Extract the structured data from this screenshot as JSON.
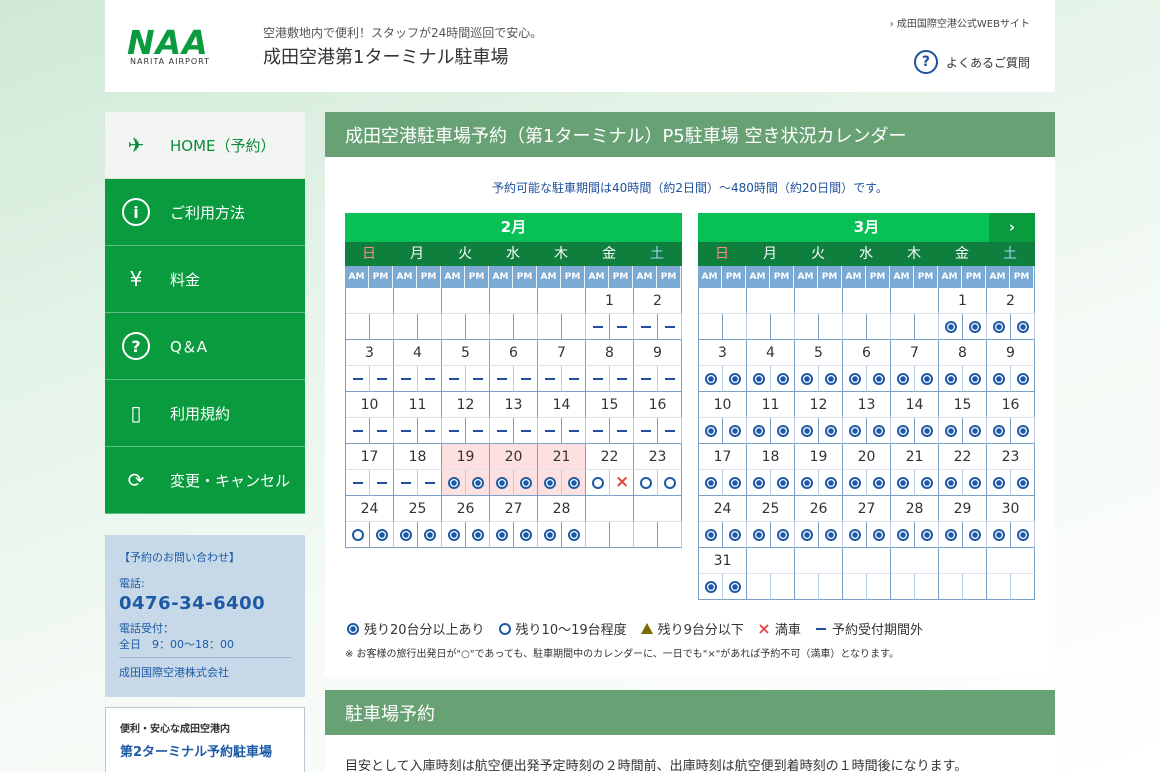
{
  "header": {
    "logo_text": "NAA",
    "logo_sub": "NARITA AIRPORT",
    "tagline": "空港敷地内で便利！スタッフが24時間巡回で安心。",
    "site_title": "成田空港第1ターミナル駐車場",
    "official_link": "成田国際空港公式WEBサイト",
    "faq_link": "よくあるご質問"
  },
  "nav": [
    {
      "label": "HOME（予約）",
      "icon": "airplane-icon",
      "glyph": "✈"
    },
    {
      "label": "ご利用方法",
      "icon": "info-icon",
      "glyph": "i"
    },
    {
      "label": "料金",
      "icon": "yen-icon",
      "glyph": "¥"
    },
    {
      "label": "Q＆A",
      "icon": "question-icon",
      "glyph": "?"
    },
    {
      "label": "利用規約",
      "icon": "document-icon",
      "glyph": "▯"
    },
    {
      "label": "変更・キャンセル",
      "icon": "refresh-icon",
      "glyph": "⟳"
    }
  ],
  "contact": {
    "heading": "【予約のお問い合わせ】",
    "phone_label": "電話:",
    "phone": "0476-34-6400",
    "hours_label": "電話受付：",
    "hours": "全日　9：00〜18：00",
    "company": "成田国際空港株式会社"
  },
  "promo": {
    "sub": "便利・安心な成田空港内",
    "main": "第2ターミナル予約駐車場"
  },
  "main": {
    "title": "成田空港駐車場予約（第1ターミナル）P5駐車場 空き状況カレンダー",
    "period_note": "予約可能な駐車期間は40時間（約2日間）〜480時間（約20日間）です。"
  },
  "calendar": {
    "weekdays": [
      "日",
      "月",
      "火",
      "水",
      "木",
      "金",
      "土"
    ],
    "ampm": [
      "AM",
      "PM"
    ],
    "next_label": "›",
    "months": [
      {
        "label": "2月",
        "weeks": [
          {
            "dates": [
              "",
              "",
              "",
              "",
              "",
              "1",
              "2"
            ],
            "status": [
              "e",
              "e",
              "e",
              "e",
              "e",
              "e",
              "e",
              "e",
              "e",
              "e",
              "-",
              "-",
              "-",
              "-"
            ],
            "pink": []
          },
          {
            "dates": [
              "3",
              "4",
              "5",
              "6",
              "7",
              "8",
              "9"
            ],
            "status": [
              "-",
              "-",
              "-",
              "-",
              "-",
              "-",
              "-",
              "-",
              "-",
              "-",
              "-",
              "-",
              "-",
              "-"
            ],
            "pink": []
          },
          {
            "dates": [
              "10",
              "11",
              "12",
              "13",
              "14",
              "15",
              "16"
            ],
            "status": [
              "-",
              "-",
              "-",
              "-",
              "-",
              "-",
              "-",
              "-",
              "-",
              "-",
              "-",
              "-",
              "-",
              "-"
            ],
            "pink": []
          },
          {
            "dates": [
              "17",
              "18",
              "19",
              "20",
              "21",
              "22",
              "23"
            ],
            "status": [
              "-",
              "-",
              "-",
              "-",
              "D",
              "D",
              "D",
              "D",
              "D",
              "D",
              "O",
              "X",
              "O",
              "O"
            ],
            "pink": [
              2,
              3,
              4
            ]
          },
          {
            "dates": [
              "24",
              "25",
              "26",
              "27",
              "28",
              "",
              ""
            ],
            "status": [
              "O",
              "D",
              "D",
              "D",
              "D",
              "D",
              "D",
              "D",
              "D",
              "D",
              "e",
              "e",
              "e",
              "e"
            ],
            "pink": []
          }
        ]
      },
      {
        "label": "3月",
        "weeks": [
          {
            "dates": [
              "",
              "",
              "",
              "",
              "",
              "1",
              "2"
            ],
            "status": [
              "e",
              "e",
              "e",
              "e",
              "e",
              "e",
              "e",
              "e",
              "e",
              "e",
              "D",
              "D",
              "D",
              "D"
            ],
            "pink": []
          },
          {
            "dates": [
              "3",
              "4",
              "5",
              "6",
              "7",
              "8",
              "9"
            ],
            "status": [
              "D",
              "D",
              "D",
              "D",
              "D",
              "D",
              "D",
              "D",
              "D",
              "D",
              "D",
              "D",
              "D",
              "D"
            ],
            "pink": []
          },
          {
            "dates": [
              "10",
              "11",
              "12",
              "13",
              "14",
              "15",
              "16"
            ],
            "status": [
              "D",
              "D",
              "D",
              "D",
              "D",
              "D",
              "D",
              "D",
              "D",
              "D",
              "D",
              "D",
              "D",
              "D"
            ],
            "pink": []
          },
          {
            "dates": [
              "17",
              "18",
              "19",
              "20",
              "21",
              "22",
              "23"
            ],
            "status": [
              "D",
              "D",
              "D",
              "D",
              "D",
              "D",
              "D",
              "D",
              "D",
              "D",
              "D",
              "D",
              "D",
              "D"
            ],
            "pink": []
          },
          {
            "dates": [
              "24",
              "25",
              "26",
              "27",
              "28",
              "29",
              "30"
            ],
            "status": [
              "D",
              "D",
              "D",
              "D",
              "D",
              "D",
              "D",
              "D",
              "D",
              "D",
              "D",
              "D",
              "D",
              "D"
            ],
            "pink": []
          },
          {
            "dates": [
              "31",
              "",
              "",
              "",
              "",
              "",
              ""
            ],
            "status": [
              "D",
              "D",
              "e",
              "e",
              "e",
              "e",
              "e",
              "e",
              "e",
              "e",
              "e",
              "e",
              "e",
              "e"
            ],
            "pink": []
          }
        ]
      }
    ]
  },
  "legend": [
    {
      "icon": "double-circle-icon",
      "cls": "dbl",
      "label": "残り20台分以上あり"
    },
    {
      "icon": "circle-icon",
      "cls": "sgl",
      "label": "残り10〜19台程度"
    },
    {
      "icon": "triangle-icon",
      "cls": "tri",
      "label": "残り9台分以下"
    },
    {
      "icon": "cross-icon",
      "cls": "x",
      "label": "満車"
    },
    {
      "icon": "dash-icon",
      "cls": "dash",
      "label": "予約受付期間外"
    }
  ],
  "footnote": "※ お客様の旅行出発日が\"○\"であっても、駐車期間中のカレンダーに、一日でも\"×\"があれば予約不可（満車）となります。",
  "section2": {
    "title": "駐車場予約",
    "body": "目安として入庫時刻は航空便出発予定時刻の２時間前、出庫時刻は航空便到着時刻の１時間後になります。"
  }
}
